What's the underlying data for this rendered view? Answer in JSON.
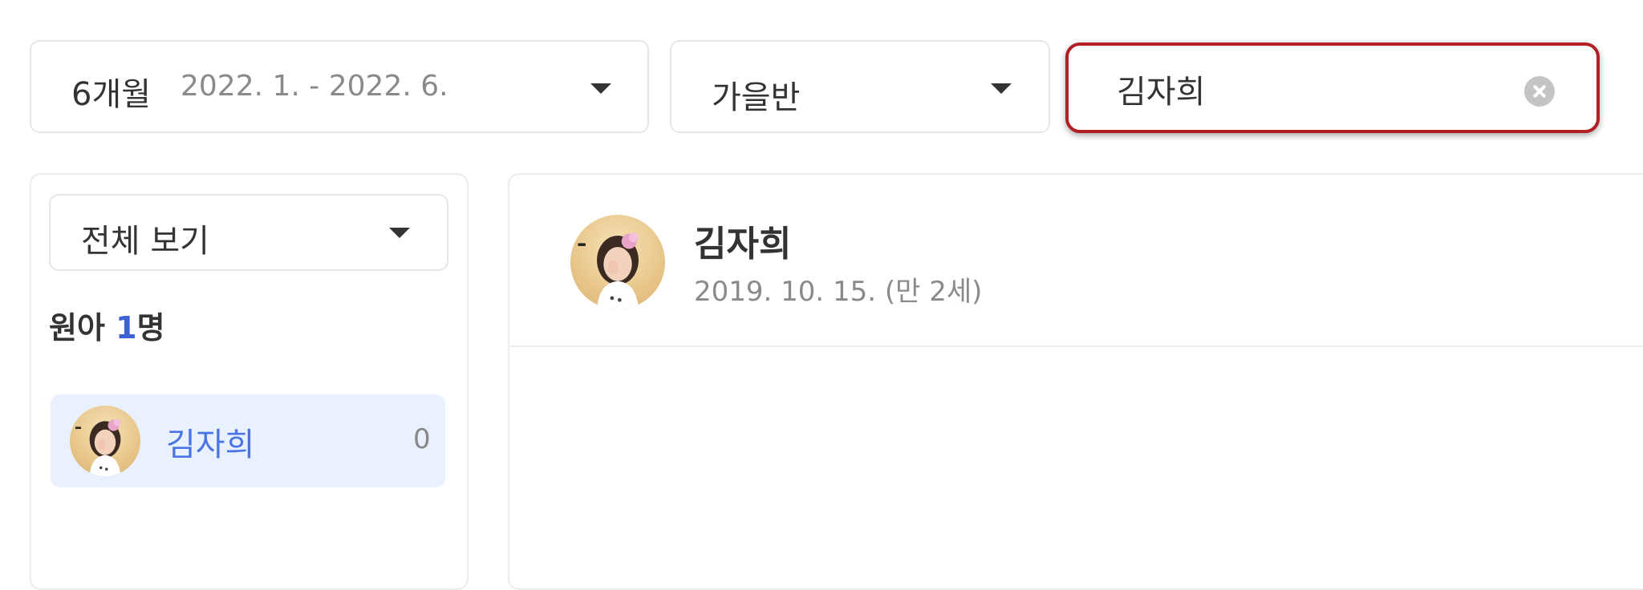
{
  "period_filter": {
    "months": "6개월",
    "range": "2022. 1. - 2022. 6."
  },
  "class_filter": {
    "selected": "가을반"
  },
  "search": {
    "value": "김자희"
  },
  "child_list": {
    "view_filter": "전체 보기",
    "count_prefix": "원아 ",
    "count_number": "1",
    "count_suffix": "명",
    "items": [
      {
        "name": "김자희",
        "count": "0"
      }
    ]
  },
  "profile": {
    "name": "김자희",
    "birth": "2019. 10. 15. (만 2세)"
  },
  "colors": {
    "accent_blue": "#4a74e6",
    "count_blue": "#3d62d6",
    "selected_bg": "#e9f1fe",
    "highlight_red": "#b21f25"
  }
}
